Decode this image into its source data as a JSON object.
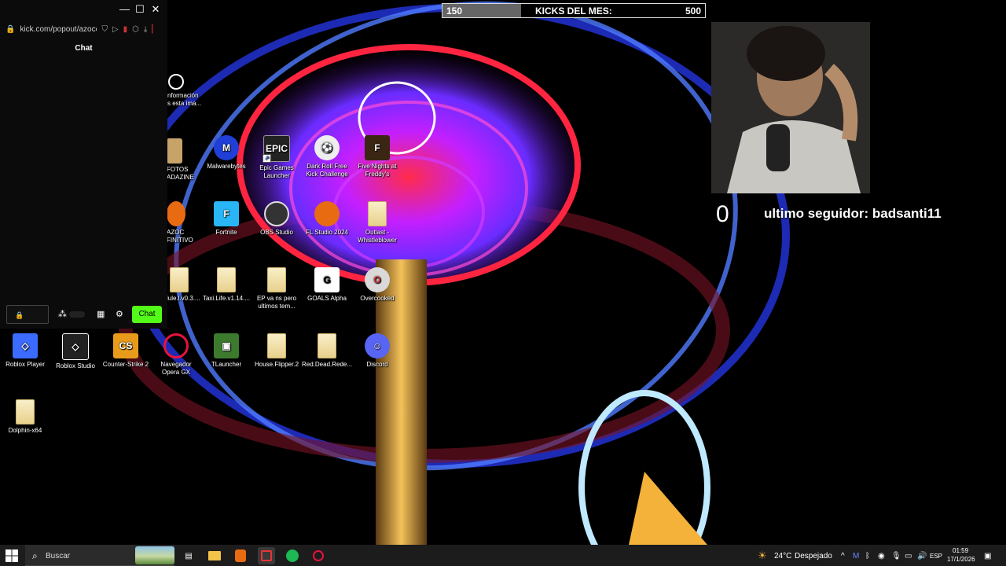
{
  "popout": {
    "window_controls": {
      "minimize": "—",
      "maximize": "☐",
      "close": "✕"
    },
    "url": "kick.com/popout/azocc",
    "chat_title": "Chat",
    "chat_input_icon": "lock-icon",
    "chat_button": "Chat"
  },
  "overlay": {
    "kicks_current": "150",
    "kicks_label": "KICKS DEL MES:",
    "kicks_goal": "500",
    "kicks_progress": 0.3,
    "follower_text": "ultimo seguidor: badsanti11",
    "zero_text": "0"
  },
  "desktop_icons": [
    {
      "label": "nformación\ns esta ima...",
      "icon": "chrome-icon"
    },
    {
      "label": "FOTOS\nADAZINE",
      "icon": "folder-photo-icon"
    },
    {
      "label": "Malwarebytes",
      "icon": "malwarebytes-icon"
    },
    {
      "label": "Epic Games\nLauncher",
      "icon": "epic-games-icon"
    },
    {
      "label": "Dark Roll Free\nKick Challenge",
      "icon": "soccer-ball-icon"
    },
    {
      "label": "Five Nights at\nFreddy's",
      "icon": "fnaf-icon"
    },
    {
      "label": "AZOC\nFINITIVO",
      "icon": "fl-studio-icon"
    },
    {
      "label": "Fortnite",
      "icon": "fortnite-icon"
    },
    {
      "label": "OBS Studio",
      "icon": "obs-icon"
    },
    {
      "label": "FL Studio 2024",
      "icon": "fl-studio-icon"
    },
    {
      "label": "Outlast -\nWhistleblower",
      "icon": "file-icon"
    },
    {
      "label": "lule.l.v0.3....",
      "icon": "file-icon"
    },
    {
      "label": "Taxi.Life.v1.14....",
      "icon": "file-icon"
    },
    {
      "label": "EP va ns pero\nultimos tem...",
      "icon": "file-icon"
    },
    {
      "label": "GOALS Alpha",
      "icon": "goals-icon"
    },
    {
      "label": "Overcooked",
      "icon": "overcooked-icon"
    },
    {
      "label": "Roblox Player",
      "icon": "roblox-icon"
    },
    {
      "label": "Roblox Studio",
      "icon": "roblox-studio-icon"
    },
    {
      "label": "Counter-Strike 2",
      "icon": "cs2-icon"
    },
    {
      "label": "Navegador\nOpera GX",
      "icon": "opera-gx-icon"
    },
    {
      "label": "TLauncher",
      "icon": "tlauncher-icon"
    },
    {
      "label": "House.Flipper.2",
      "icon": "file-icon"
    },
    {
      "label": "Red.Dead.Rede...",
      "icon": "file-icon"
    },
    {
      "label": "Discord",
      "icon": "discord-icon"
    },
    {
      "label": "Dolphin-x64",
      "icon": "file-icon"
    }
  ],
  "taskbar": {
    "search_placeholder": "Buscar",
    "weather": "24°C",
    "weather_desc": "Despejado",
    "lang": "ESP",
    "time": "01:59",
    "date": "17/1/2026"
  }
}
